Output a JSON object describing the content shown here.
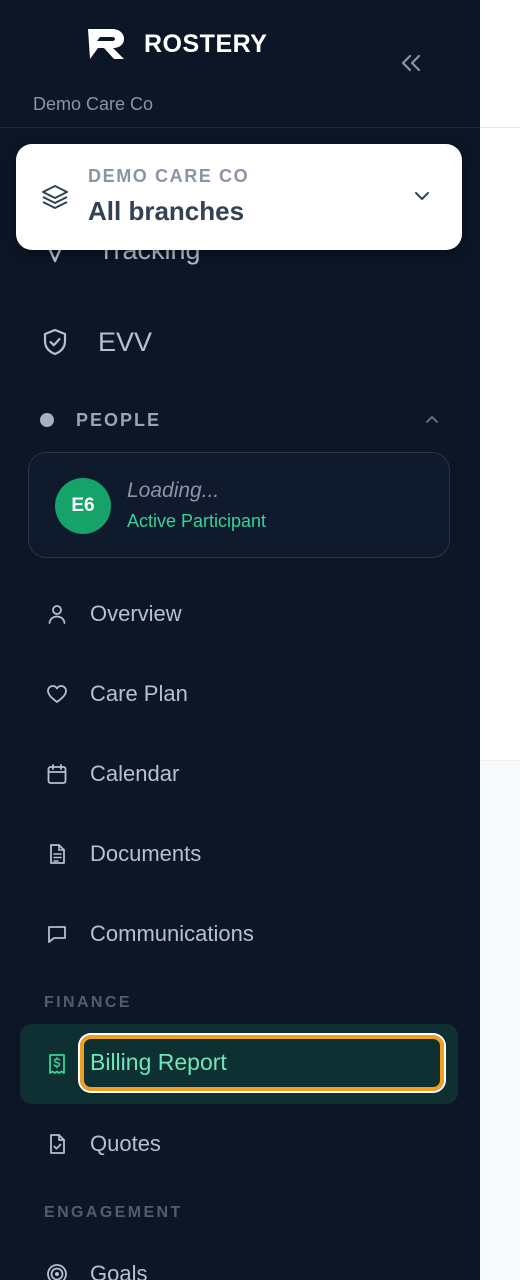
{
  "brand": {
    "name": "ROSTERY",
    "org_caption": "Demo Care Co"
  },
  "org_switcher": {
    "eyebrow": "DEMO CARE CO",
    "value": "All branches"
  },
  "nav_top": [
    {
      "label": "Tracking",
      "icon": "navigation-icon"
    },
    {
      "label": "EVV",
      "icon": "shield-check-icon"
    }
  ],
  "people": {
    "title": "PEOPLE",
    "participant": {
      "initials": "E6",
      "name": "Loading...",
      "status": "Active Participant"
    },
    "items": [
      {
        "label": "Overview",
        "icon": "user-icon"
      },
      {
        "label": "Care Plan",
        "icon": "heart-icon"
      },
      {
        "label": "Calendar",
        "icon": "calendar-icon"
      },
      {
        "label": "Documents",
        "icon": "document-icon"
      },
      {
        "label": "Communications",
        "icon": "message-icon"
      }
    ]
  },
  "finance": {
    "title": "FINANCE",
    "items": [
      {
        "label": "Billing Report",
        "icon": "receipt-icon",
        "active": true
      },
      {
        "label": "Quotes",
        "icon": "file-check-icon"
      }
    ]
  },
  "engagement": {
    "title": "ENGAGEMENT",
    "items": [
      {
        "label": "Goals",
        "icon": "target-icon"
      }
    ]
  },
  "colors": {
    "sidebar_bg": "#0d1627",
    "accent_green": "#34d399",
    "active_bg": "#0e3032",
    "focus_ring": "#f0a01e"
  }
}
